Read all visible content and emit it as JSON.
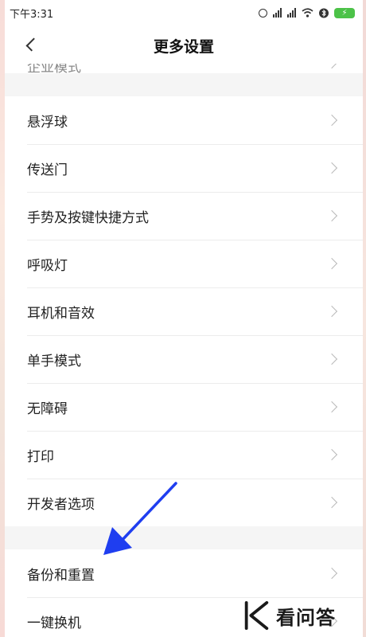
{
  "status_bar": {
    "time": "下午3:31"
  },
  "header": {
    "title": "更多设置"
  },
  "top_partial_item": {
    "label": "企业模式"
  },
  "group1": [
    {
      "label": "悬浮球"
    },
    {
      "label": "传送门"
    },
    {
      "label": "手势及按键快捷方式"
    },
    {
      "label": "呼吸灯"
    },
    {
      "label": "耳机和音效"
    },
    {
      "label": "单手模式"
    },
    {
      "label": "无障碍"
    },
    {
      "label": "打印"
    },
    {
      "label": "开发者选项"
    }
  ],
  "group2": [
    {
      "label": "备份和重置"
    },
    {
      "label": "一键换机"
    }
  ],
  "watermark": {
    "text": "看问答"
  },
  "colors": {
    "arrow": "#1f3ef0",
    "battery": "#4cc248",
    "divider": "#ececec"
  }
}
